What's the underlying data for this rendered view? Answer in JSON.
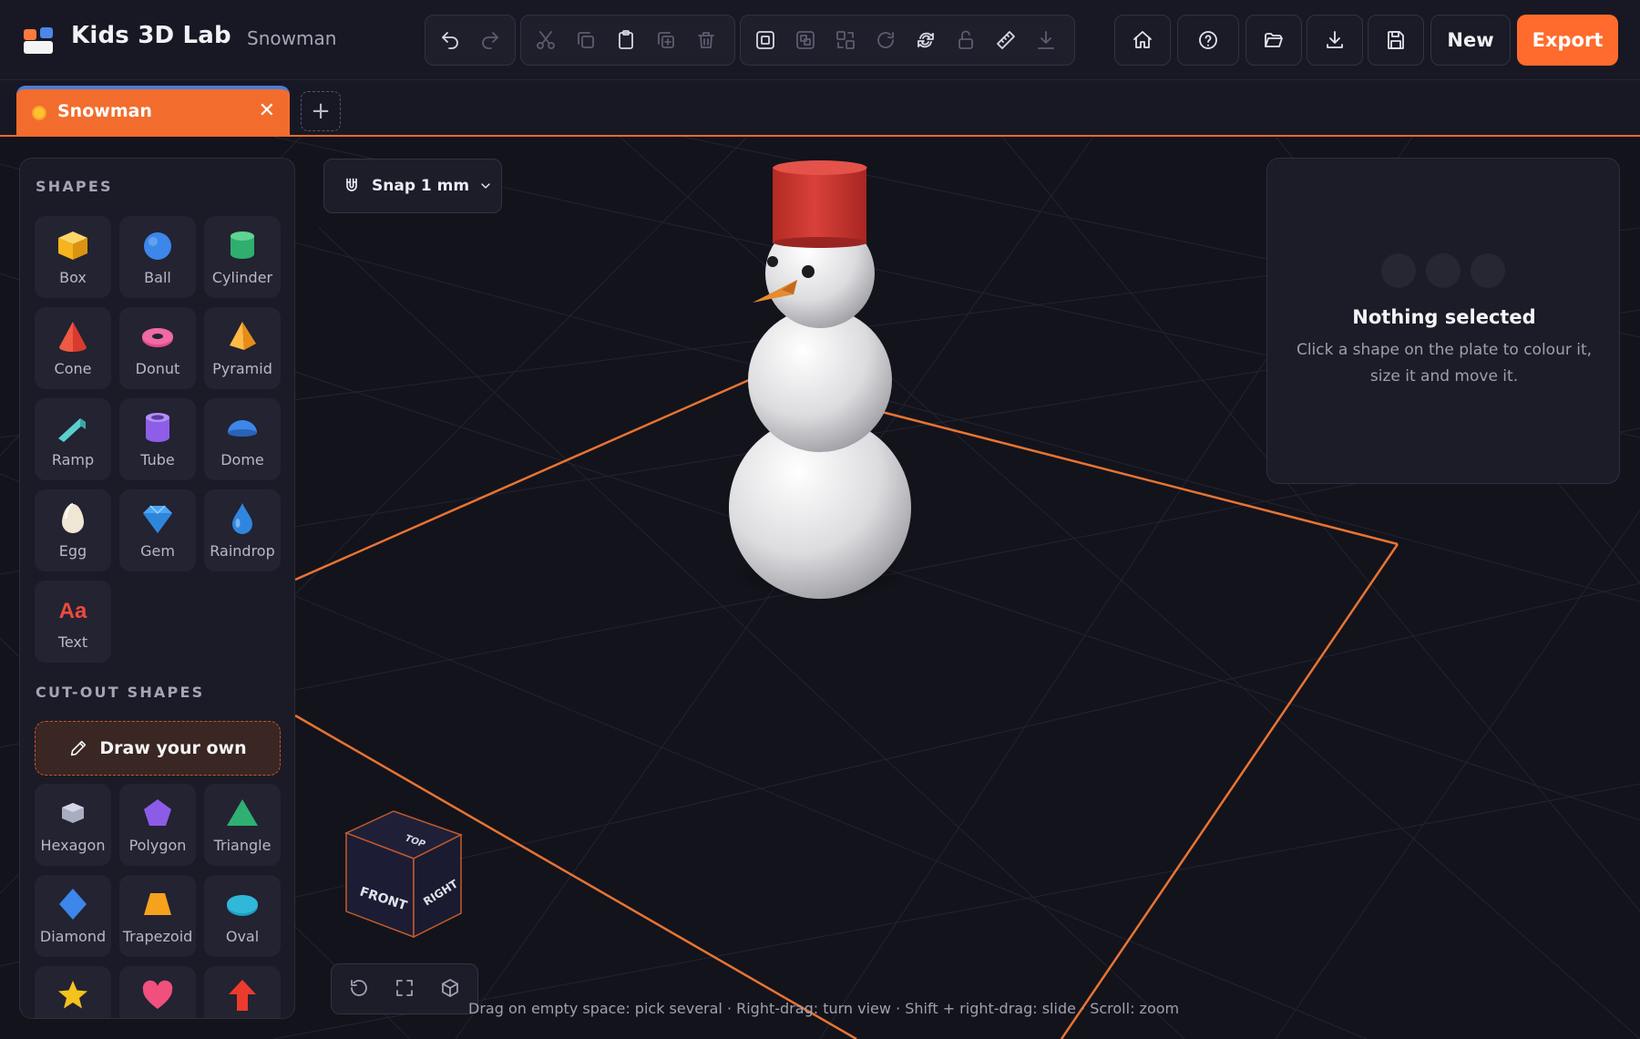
{
  "header": {
    "app_title": "Kids 3D Lab",
    "document_title": "Snowman",
    "new_label": "New",
    "export_label": "Export",
    "accent_color": "#ff6b2c"
  },
  "toolbar_icons": {
    "history": [
      "undo-icon",
      "redo-icon"
    ],
    "edit": [
      "cut-icon",
      "copy-icon",
      "paste-icon",
      "duplicate-icon",
      "delete-icon"
    ],
    "arrange": [
      "group-icon",
      "ungroup-icon",
      "align-icon",
      "rotate-icon",
      "flip-icon",
      "lock-icon",
      "ruler-icon",
      "drop-to-plate-icon"
    ],
    "file": [
      "home-icon",
      "help-icon",
      "open-folder-icon",
      "download-icon",
      "save-icon"
    ]
  },
  "tabs": [
    {
      "label": "Snowman",
      "active": true
    }
  ],
  "sidebar": {
    "shapes_title": "SHAPES",
    "shapes": [
      {
        "label": "Box",
        "icon": "box-icon"
      },
      {
        "label": "Ball",
        "icon": "ball-icon"
      },
      {
        "label": "Cylinder",
        "icon": "cylinder-icon"
      },
      {
        "label": "Cone",
        "icon": "cone-icon"
      },
      {
        "label": "Donut",
        "icon": "donut-icon"
      },
      {
        "label": "Pyramid",
        "icon": "pyramid-icon"
      },
      {
        "label": "Ramp",
        "icon": "ramp-icon"
      },
      {
        "label": "Tube",
        "icon": "tube-icon"
      },
      {
        "label": "Dome",
        "icon": "dome-icon"
      },
      {
        "label": "Egg",
        "icon": "egg-icon"
      },
      {
        "label": "Gem",
        "icon": "gem-icon"
      },
      {
        "label": "Raindrop",
        "icon": "raindrop-icon"
      },
      {
        "label": "Text",
        "icon": "text-icon",
        "glyph": "Aa"
      }
    ],
    "cutout_title": "CUT-OUT SHAPES",
    "draw_own_label": "Draw your own",
    "cutouts": [
      {
        "label": "Hexagon",
        "icon": "hexagon-icon"
      },
      {
        "label": "Polygon",
        "icon": "polygon-icon"
      },
      {
        "label": "Triangle",
        "icon": "triangle-icon"
      },
      {
        "label": "Diamond",
        "icon": "diamond-icon"
      },
      {
        "label": "Trapezoid",
        "icon": "trapezoid-icon"
      },
      {
        "label": "Oval",
        "icon": "oval-icon"
      },
      {
        "label": "",
        "icon": "star-icon"
      },
      {
        "label": "",
        "icon": "heart-icon"
      },
      {
        "label": "",
        "icon": "arrow-icon"
      }
    ]
  },
  "snap": {
    "label": "Snap 1 mm"
  },
  "properties": {
    "title": "Nothing selected",
    "description": "Click a shape on the plate to colour it, size it and move it."
  },
  "view_cube": {
    "top": "TOP",
    "front": "FRONT",
    "right": "RIGHT"
  },
  "hint": "Drag on empty space: pick several · Right-drag: turn view · Shift + right-drag: slide · Scroll: zoom"
}
